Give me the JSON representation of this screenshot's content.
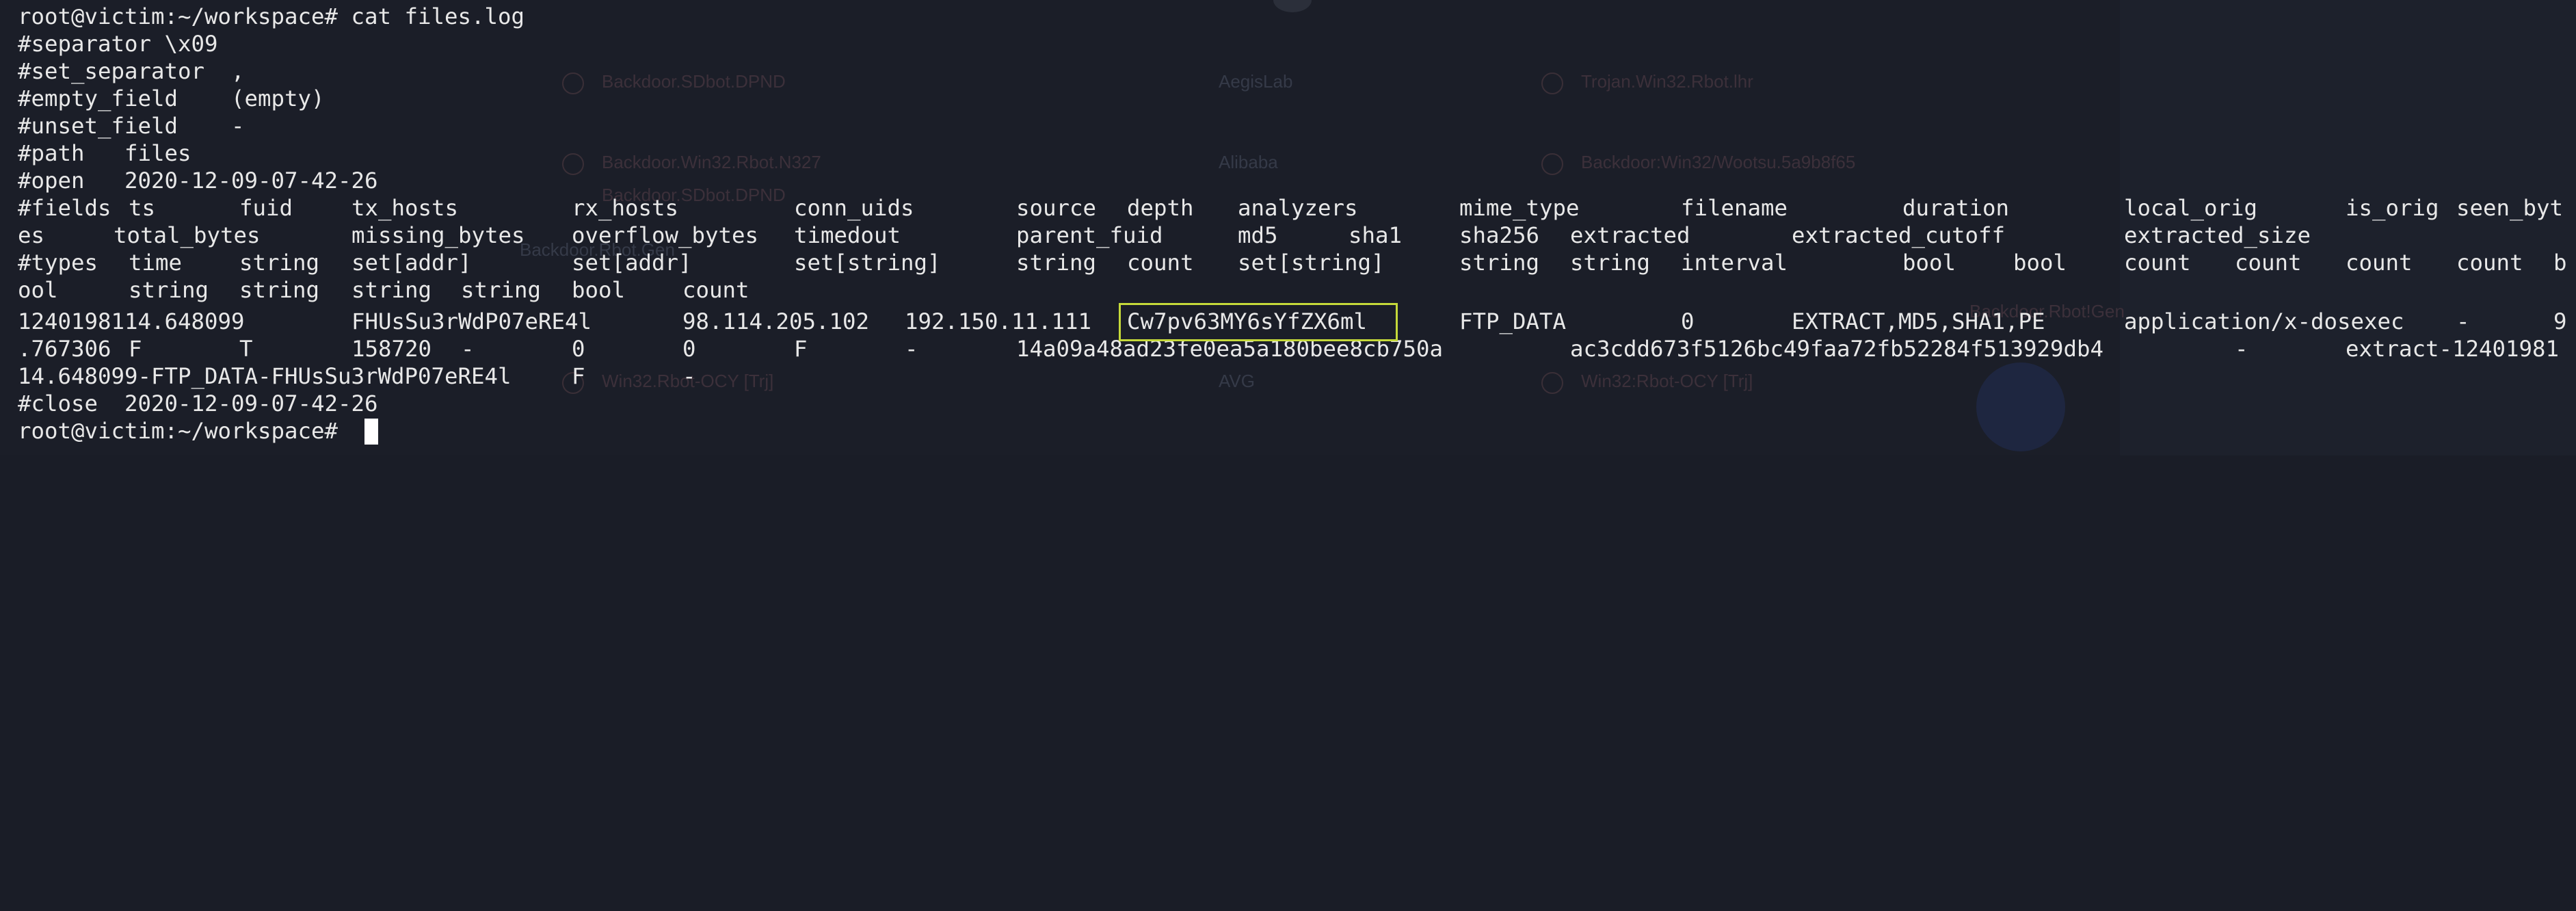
{
  "terminal": {
    "command_line": "root@victim:~/workspace# cat files.log",
    "meta": [
      "#separator \\x09",
      "#set_separator  ,",
      "#empty_field    (empty)",
      "#unset_field    -",
      "#path   files",
      "#open   2020-12-09-07-42-26"
    ],
    "fields_row1": [
      "#fields",
      "ts",
      "fuid",
      "tx_hosts",
      "rx_hosts",
      "conn_uids",
      "source",
      "depth",
      "analyzers",
      "mime_type",
      "filename",
      "duration",
      "local_orig",
      "is_orig",
      "seen_byt"
    ],
    "fields_row2": [
      "es",
      "total_bytes",
      "missing_bytes",
      "overflow_bytes",
      "timedout",
      "parent_fuid",
      "md5",
      "sha1",
      "sha256",
      "extracted",
      "extracted_cutoff",
      "extracted_size"
    ],
    "types_row1": [
      "#types",
      "time",
      "string",
      "set[addr]",
      "set[addr]",
      "set[string]",
      "string",
      "count",
      "set[string]",
      "string",
      "string",
      "interval",
      "bool",
      "bool",
      "count",
      "count",
      "count",
      "count",
      "b"
    ],
    "types_row2": [
      "ool",
      "string",
      "string",
      "string",
      "string",
      "bool",
      "count"
    ],
    "record_row1": [
      "1240198114.648099",
      "FHUsSu3rWdP07eRE4l",
      "98.114.205.102",
      "192.150.11.111",
      "Cw7pv63MY6sYfZX6ml",
      "FTP_DATA",
      "0",
      "EXTRACT,MD5,SHA1,PE",
      "application/x-dosexec",
      "-",
      "9"
    ],
    "record_row2": [
      ".767306",
      "F",
      "T",
      "158720",
      "-",
      "0",
      "0",
      "F",
      "-",
      "14a09a48ad23fe0ea5a180bee8cb750a",
      "ac3cdd673f5126bc49faa72fb52284f513929db4",
      "-",
      "extract-12401981"
    ],
    "record_row3": [
      "14.648099-FTP_DATA-FHUsSu3rWdP07eRE4l",
      "F",
      "-"
    ],
    "close_line": "#close  2020-12-09-07-42-26",
    "prompt_line": "root@victim:~/workspace# "
  },
  "background_ghost": {
    "items": [
      "Backdoor.SDbot.DPND",
      "AegisLab",
      "Trojan.Win32.Rbot.lhr",
      "Backdoor.Win32.Rbot.N327",
      "Alibaba",
      "Backdoor:Win32/Wootsu.5a9b8f65",
      "Win32.Rbot-OCY [Trj]",
      "AVG",
      "Win32:Rbot-OCY [Trj]",
      "Backdoor.Rbot.Gen",
      "Backdoor.SDbot.DPND",
      "Backdoor.Rbot!Gen"
    ]
  },
  "colors": {
    "background": "#1b1e28",
    "text": "#e8e8e8",
    "highlight_border": "#c5d93a",
    "cursor": "#ffffff"
  }
}
